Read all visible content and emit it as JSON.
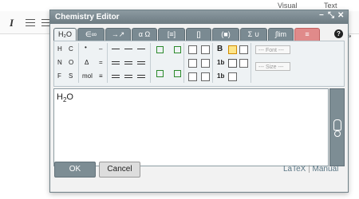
{
  "background": {
    "tabs": [
      "Visual",
      "Text"
    ]
  },
  "dialog": {
    "title": "Chemistry Editor",
    "controls": {
      "minimize": "−",
      "restore": "⤡",
      "close": "✕"
    },
    "tabs": [
      "H₂O",
      "∈∞",
      "→↗",
      "α Ω",
      "[≡]",
      "[]",
      "(■)",
      "Σ ∪",
      "∫lim",
      "≡"
    ],
    "help": "?",
    "palette": {
      "elements": [
        "H",
        "C",
        "N",
        "O",
        "F",
        "S"
      ],
      "symbols": [
        "•",
        "–",
        "Δ",
        "=",
        "mol",
        "≡"
      ],
      "font_label": "--- Font ---",
      "size_label": "--- Size ---",
      "bold": "B",
      "bold_sub": "1b",
      "italic_tt": "1b"
    },
    "formula": {
      "base": "H",
      "sub": "2",
      "tail": "O"
    },
    "ok_label": "OK",
    "cancel_label": "Cancel",
    "link_latex": "LaTeX",
    "link_sep": "|",
    "link_manual": "Manual"
  }
}
